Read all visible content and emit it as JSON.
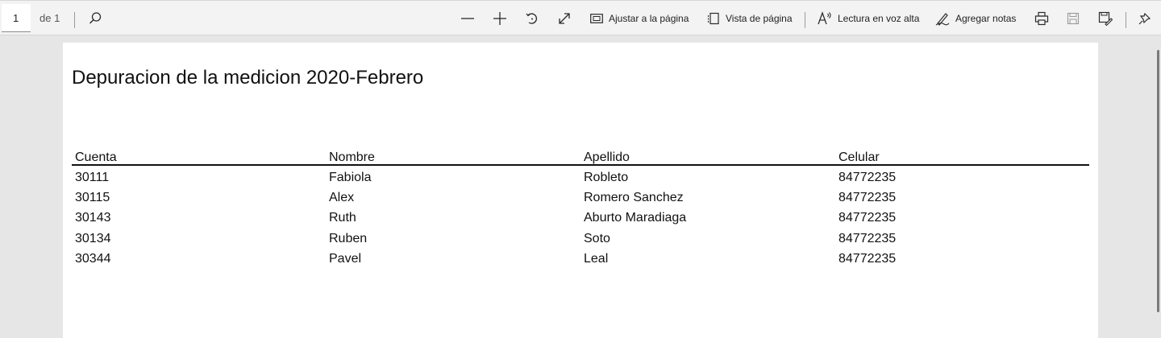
{
  "toolbar": {
    "page_number": "1",
    "page_total": "de 1",
    "fit_page_label": "Ajustar a la página",
    "page_view_label": "Vista de página",
    "read_aloud_label": "Lectura en voz alta",
    "add_notes_label": "Agregar notas",
    "icons": [
      "search-icon",
      "zoom-out-icon",
      "zoom-in-icon",
      "rotate-icon",
      "fullscreen-icon",
      "fit-page-icon",
      "page-view-icon",
      "read-aloud-icon",
      "add-notes-icon",
      "print-icon",
      "save-icon",
      "save-as-icon",
      "pin-icon"
    ]
  },
  "document": {
    "title": "Depuracion de la medicion 2020-Febrero",
    "columns": [
      "Cuenta",
      "Nombre",
      "Apellido",
      "Celular"
    ],
    "rows": [
      [
        "30111",
        "Fabiola",
        "Robleto",
        "84772235"
      ],
      [
        "30115",
        "Alex",
        "Romero Sanchez",
        "84772235"
      ],
      [
        "30143",
        "Ruth",
        "Aburto Maradiaga",
        "84772235"
      ],
      [
        "30134",
        "Ruben",
        "Soto",
        "84772235"
      ],
      [
        "30344",
        "Pavel",
        "Leal",
        "84772235"
      ]
    ]
  }
}
